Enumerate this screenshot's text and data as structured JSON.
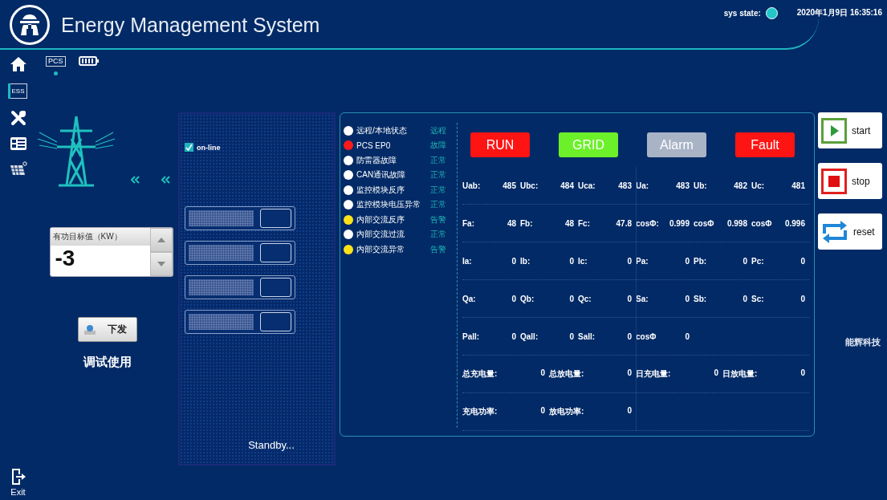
{
  "header": {
    "title": "Energy Management System",
    "sys_state_label": "sys state:",
    "datetime": "2020年1月9日 16:35:16"
  },
  "sidebar": {
    "items": [
      {
        "kind": "home",
        "selected": false
      },
      {
        "kind": "ess",
        "label": "ESS",
        "selected": true
      },
      {
        "kind": "tools",
        "selected": false
      },
      {
        "kind": "list",
        "selected": false
      },
      {
        "kind": "solar",
        "selected": false
      }
    ],
    "exit": {
      "label": "Exit"
    }
  },
  "tabs": [
    {
      "kind": "pcs",
      "label": "PCS",
      "selected": true
    },
    {
      "kind": "battery",
      "selected": false
    }
  ],
  "setpoint": {
    "label": "有功目标值（KW）",
    "value": "-3"
  },
  "send_button": {
    "label": "下发"
  },
  "note": "调试使用",
  "cabinet": {
    "online": {
      "label": "on-line",
      "checked": true
    },
    "status_text": "Standby..."
  },
  "status_list": [
    {
      "label": "远程/本地状态",
      "state": "远程",
      "color": "#ffffff"
    },
    {
      "label": "PCS EP0",
      "state": "故障",
      "color": "#ff1a1a"
    },
    {
      "label": "防雷器故障",
      "state": "正常",
      "color": "#ffffff"
    },
    {
      "label": "CAN通讯故障",
      "state": "正常",
      "color": "#ffffff"
    },
    {
      "label": "监控模块反序",
      "state": "正常",
      "color": "#ffffff"
    },
    {
      "label": "监控模块电压异常",
      "state": "正常",
      "color": "#ffffff"
    },
    {
      "label": "内部交流反序",
      "state": "告警",
      "color": "#ffe11a"
    },
    {
      "label": "内部交流过流",
      "state": "正常",
      "color": "#ffffff"
    },
    {
      "label": "内部交流异常",
      "state": "告警",
      "color": "#ffe11a"
    }
  ],
  "indicators": [
    {
      "label": "RUN",
      "color": "#ff1414"
    },
    {
      "label": "GRID",
      "color": "#6cf02a"
    },
    {
      "label": "Alarm",
      "color": "#a9b3c6"
    },
    {
      "label": "Fault",
      "color": "#ff1414"
    }
  ],
  "measurements": [
    {
      "kind": "phase",
      "cells": [
        {
          "label": "Uab:",
          "value": "485"
        },
        {
          "label": "Ubc:",
          "value": "484"
        },
        {
          "label": "Uca:",
          "value": "483"
        },
        {
          "label": "Ua:",
          "value": "483"
        },
        {
          "label": "Ub:",
          "value": "482"
        },
        {
          "label": "Uc:",
          "value": "481"
        }
      ]
    },
    {
      "kind": "phase",
      "cells": [
        {
          "label": "Fa:",
          "value": "48"
        },
        {
          "label": "Fb:",
          "value": "48"
        },
        {
          "label": "Fc:",
          "value": "47.8"
        },
        {
          "label": "cosΦ:",
          "value": "0.999"
        },
        {
          "label": "cosΦ",
          "value": "0.998"
        },
        {
          "label": "cosΦ",
          "value": "0.996"
        }
      ]
    },
    {
      "kind": "phase",
      "cells": [
        {
          "label": "Ia:",
          "value": "0"
        },
        {
          "label": "Ib:",
          "value": "0"
        },
        {
          "label": "Ic:",
          "value": "0"
        },
        {
          "label": "Pa:",
          "value": "0"
        },
        {
          "label": "Pb:",
          "value": "0"
        },
        {
          "label": "Pc:",
          "value": "0"
        }
      ]
    },
    {
      "kind": "phase",
      "cells": [
        {
          "label": "Qa:",
          "value": "0"
        },
        {
          "label": "Qb:",
          "value": "0"
        },
        {
          "label": "Qc:",
          "value": "0"
        },
        {
          "label": "Sa:",
          "value": "0"
        },
        {
          "label": "Sb:",
          "value": "0"
        },
        {
          "label": "Sc:",
          "value": "0"
        }
      ]
    },
    {
      "kind": "phase",
      "cells": [
        {
          "label": "Pall:",
          "value": "0"
        },
        {
          "label": "Qall:",
          "value": "0"
        },
        {
          "label": "Sall:",
          "value": "0"
        },
        {
          "label": "cosΦ",
          "value": "0"
        }
      ]
    },
    {
      "kind": "energy",
      "cells": [
        {
          "label": "总充电量:",
          "value": "0"
        },
        {
          "label": "总放电量:",
          "value": "0"
        },
        {
          "label": "日充电量:",
          "value": "0"
        },
        {
          "label": "日放电量:",
          "value": "0"
        }
      ]
    },
    {
      "kind": "energy",
      "cells": [
        {
          "label": "充电功率:",
          "value": "0"
        },
        {
          "label": "放电功率:",
          "value": "0"
        }
      ]
    }
  ],
  "actions": [
    {
      "kind": "start",
      "label": "start"
    },
    {
      "kind": "stop",
      "label": "stop"
    },
    {
      "kind": "reset",
      "label": "reset"
    }
  ],
  "brand": "能辉科技"
}
